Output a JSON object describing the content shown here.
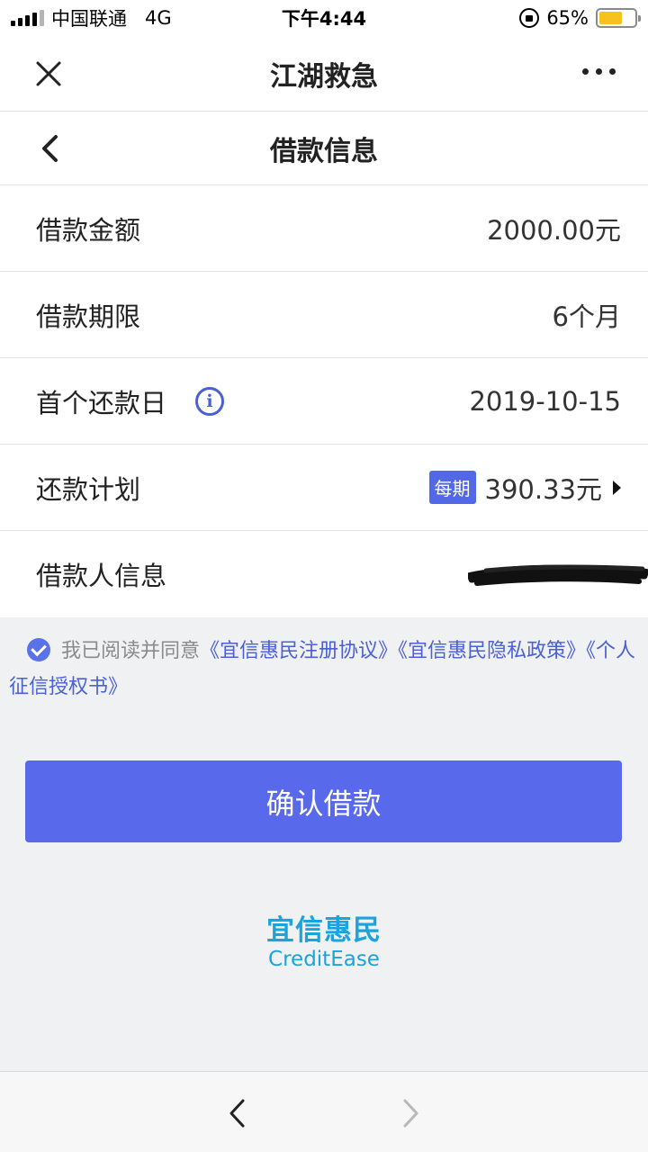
{
  "status_bar": {
    "carrier": "中国联通",
    "network": "4G",
    "time": "下午4:44",
    "battery": "65%",
    "battery_level": 0.65
  },
  "header": {
    "title": "江湖救急"
  },
  "sub_header": {
    "title": "借款信息"
  },
  "loan_info": {
    "amount_label": "借款金额",
    "amount_value": "2000.00元",
    "term_label": "借款期限",
    "term_value": "6个月",
    "first_due_label": "首个还款日",
    "first_due_value": "2019-10-15",
    "plan_label": "还款计划",
    "plan_badge": "每期",
    "plan_value": "390.33元",
    "borrower_label": "借款人信息"
  },
  "agreement": {
    "prefix": "我已阅读并同意",
    "link1": "《宜信惠民注册协议》",
    "link2": "《宜信惠民隐私政策》",
    "link3": "《个人征信授权书》"
  },
  "actions": {
    "confirm_label": "确认借款"
  },
  "brand": {
    "cn": "宜信惠民",
    "en": "CreditEase"
  },
  "colors": {
    "primary": "#5869ec",
    "link": "#4a60d6",
    "brand": "#1aa3dc",
    "background": "#f0f1f3"
  }
}
